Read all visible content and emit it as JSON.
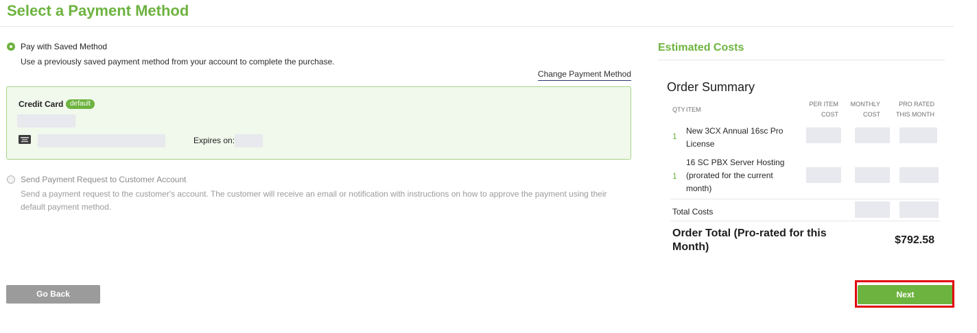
{
  "page": {
    "title": "Select a Payment Method"
  },
  "colors": {
    "accent": "#6db33f",
    "highlight": "#e0000a",
    "placeholder": "#e7e9ee"
  },
  "payment": {
    "saved": {
      "label": "Pay with Saved Method",
      "description": "Use a previously saved payment method from your account to complete the purchase.",
      "selected": true
    },
    "change_link": "Change Payment Method",
    "card": {
      "type": "Credit Card",
      "badge": "default",
      "expires_label": "Expires on:",
      "icon": "credit-card-icon"
    },
    "request": {
      "label": "Send Payment Request to Customer Account",
      "description": "Send a payment request to the customer's account. The customer will receive an email or notification with instructions on how to approve the payment using their default payment method.",
      "selected": false
    }
  },
  "costs": {
    "heading": "Estimated Costs",
    "summary_title": "Order Summary",
    "columns": {
      "qty": "QTY",
      "item": "ITEM",
      "per_item": "PER ITEM COST",
      "monthly": "MONTHLY COST",
      "prorated": "PRO RATED THIS MONTH"
    },
    "items": [
      {
        "qty": "1",
        "name": "New 3CX Annual 16sc Pro License"
      },
      {
        "qty": "1",
        "name": "16 SC PBX Server Hosting (prorated for the current month)"
      }
    ],
    "total_costs_label": "Total Costs",
    "order_total_label": "Order Total (Pro-rated for this Month)",
    "order_total_value": "$792.58"
  },
  "actions": {
    "back": "Go Back",
    "next": "Next"
  }
}
